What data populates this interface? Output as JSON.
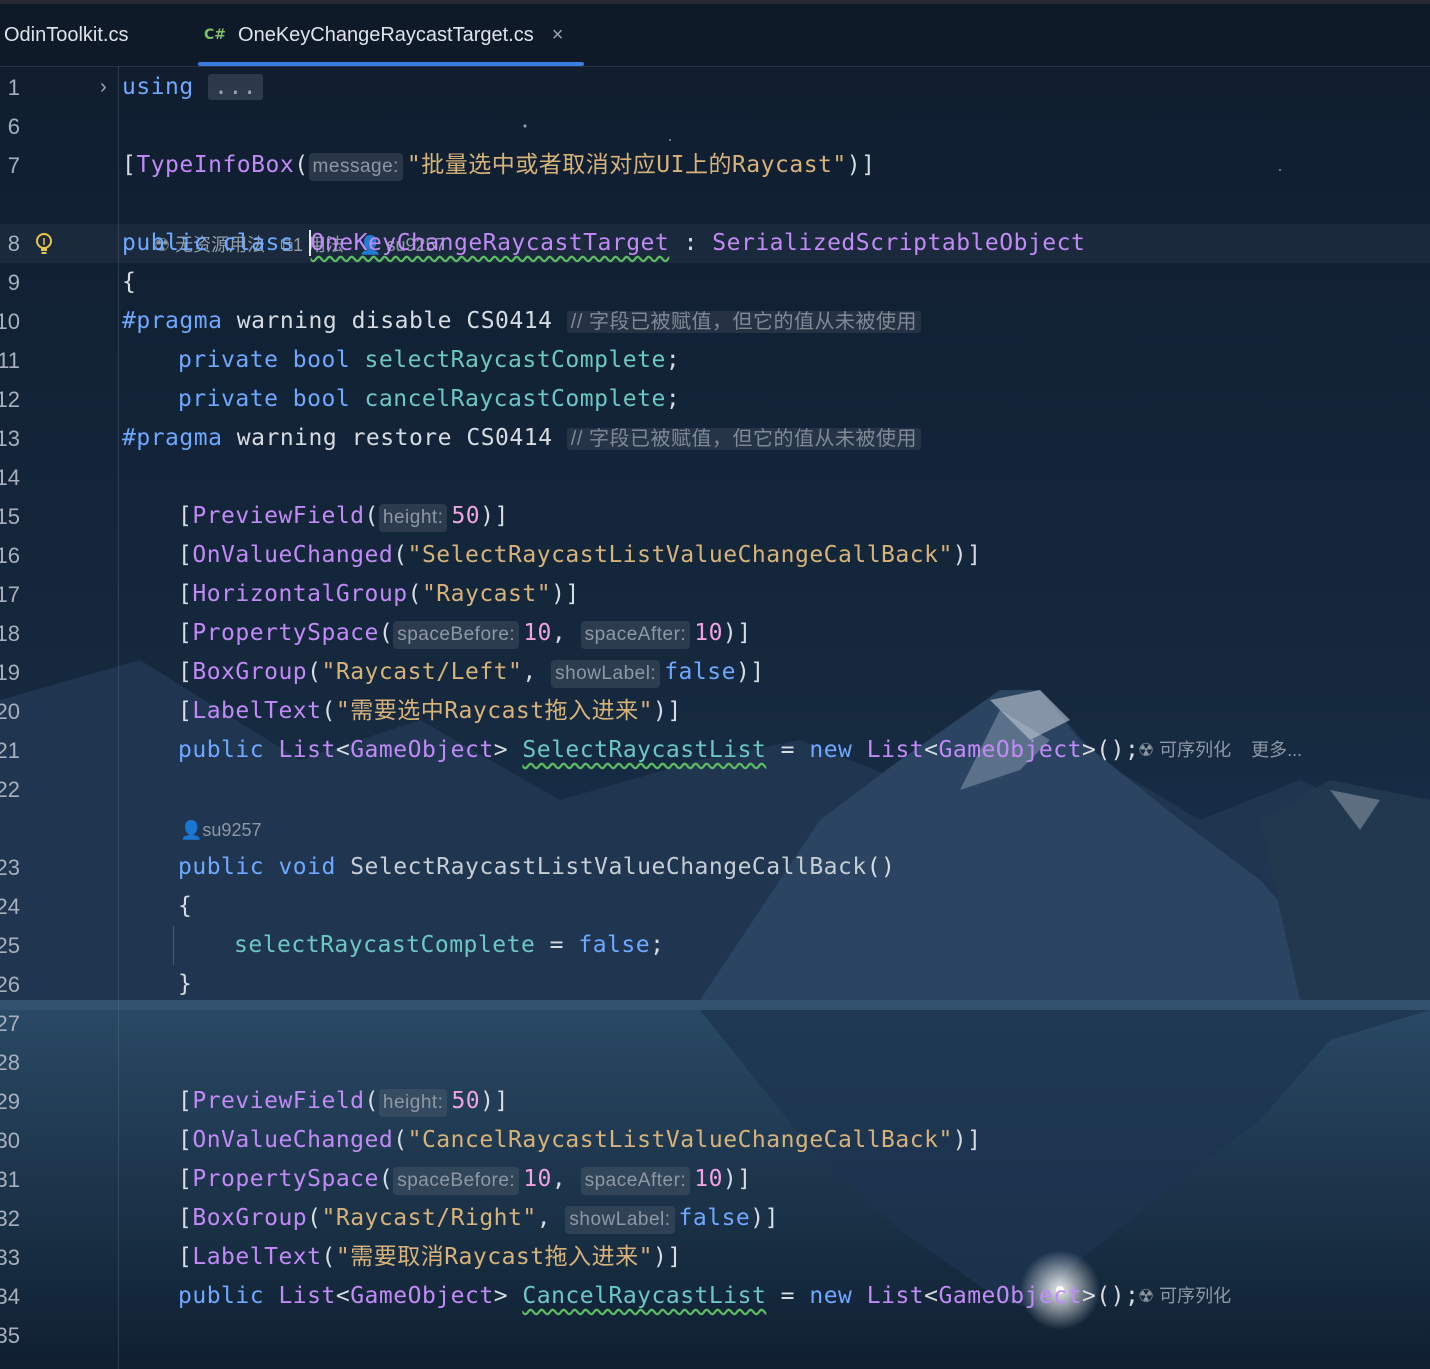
{
  "tabs": [
    {
      "label": "OdinToolkit.cs",
      "active": false
    },
    {
      "label": "OneKeyChangeRaycastTarget.cs",
      "lang": "C#",
      "active": true
    }
  ],
  "code": {
    "fold_ellipsis": "...",
    "meta_class": {
      "usages_none": "无资源用法",
      "usages_count": "1 用法",
      "author": "su9257"
    },
    "meta_method": {
      "author": "su9257"
    },
    "inline_hint_serializable": "可序列化",
    "inline_hint_more": "更多...",
    "lines": [
      {
        "n": "1"
      },
      {
        "n": "6"
      },
      {
        "n": "7"
      },
      {
        "n": "8"
      },
      {
        "n": "9"
      },
      {
        "n": "10"
      },
      {
        "n": "11"
      },
      {
        "n": "12"
      },
      {
        "n": "13"
      },
      {
        "n": "14"
      },
      {
        "n": "15"
      },
      {
        "n": "16"
      },
      {
        "n": "17"
      },
      {
        "n": "18"
      },
      {
        "n": "19"
      },
      {
        "n": "20"
      },
      {
        "n": "21"
      },
      {
        "n": "22"
      },
      {
        "n": "23"
      },
      {
        "n": "24"
      },
      {
        "n": "25"
      },
      {
        "n": "26"
      },
      {
        "n": "27"
      },
      {
        "n": "28"
      },
      {
        "n": "29"
      },
      {
        "n": "30"
      },
      {
        "n": "31"
      },
      {
        "n": "32"
      },
      {
        "n": "33"
      },
      {
        "n": "34"
      },
      {
        "n": "35"
      }
    ],
    "text": {
      "using": "using",
      "typeinfobox_attr": "TypeInfoBox",
      "param_message": "message:",
      "typeinfobox_str": "\"批量选中或者取消对应UI上的Raycast\"",
      "public": "public",
      "class": "class",
      "class_name": "OneKeyChangeRaycastTarget",
      "base_class": "SerializedScriptableObject",
      "pragma": "#pragma",
      "pragma_disable": "warning disable CS0414",
      "pragma_restore": "warning restore CS0414",
      "pragma_comment": "// 字段已被赋值，但它的值从未被使用",
      "private": "private",
      "bool": "bool",
      "field_select_complete": "selectRaycastComplete",
      "field_cancel_complete": "cancelRaycastComplete",
      "previewfield": "PreviewField",
      "param_height": "height:",
      "num_50": "50",
      "onvaluechanged": "OnValueChanged",
      "select_callback_str": "\"SelectRaycastListValueChangeCallBack\"",
      "cancel_callback_str": "\"CancelRaycastListValueChangeCallBack\"",
      "horizontalgroup": "HorizontalGroup",
      "raycast_str": "\"Raycast\"",
      "propertyspace": "PropertySpace",
      "param_space_before": "spaceBefore:",
      "param_space_after": "spaceAfter:",
      "num_10": "10",
      "boxgroup": "BoxGroup",
      "raycast_left_str": "\"Raycast/Left\"",
      "raycast_right_str": "\"Raycast/Right\"",
      "param_show_label": "showLabel:",
      "false": "false",
      "labeltext": "LabelText",
      "label_select_str": "\"需要选中Raycast拖入进来\"",
      "label_cancel_str": "\"需要取消Raycast拖入进来\"",
      "list": "List",
      "gameobject": "GameObject",
      "select_list": "SelectRaycastList",
      "cancel_list": "CancelRaycastList",
      "new": "new",
      "void": "void",
      "method_name": "SelectRaycastListValueChangeCallBack"
    }
  }
}
